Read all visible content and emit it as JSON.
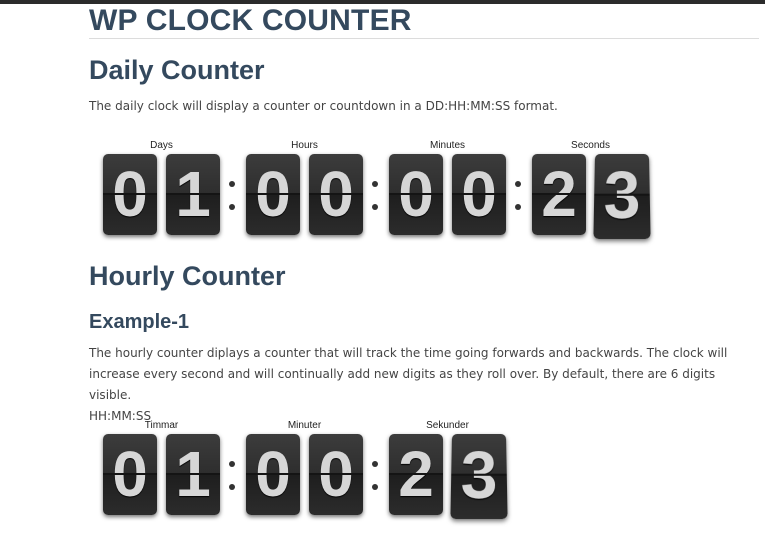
{
  "site_title": "WP CLOCK COUNTER",
  "daily": {
    "heading": "Daily Counter",
    "description": "The daily clock will display a counter or countdown in a DD:HH:MM:SS format.",
    "labels": [
      "Days",
      "Hours",
      "Minutes",
      "Seconds"
    ],
    "digits": [
      "0",
      "1",
      "0",
      "0",
      "0",
      "0",
      "2",
      "3"
    ]
  },
  "hourly": {
    "heading": "Hourly Counter",
    "example_heading": "Example-1",
    "description_line1": "The hourly counter diplays a counter that will track the time going forwards and backwards. The clock will",
    "description_line2": "increase every second and will continually add new digits as they roll over. By default, there are 6 digits visible.",
    "description_line3": "HH:MM:SS",
    "labels": [
      "Timmar",
      "Minuter",
      "Sekunder"
    ],
    "digits": [
      "0",
      "1",
      "0",
      "0",
      "2",
      "3"
    ]
  }
}
